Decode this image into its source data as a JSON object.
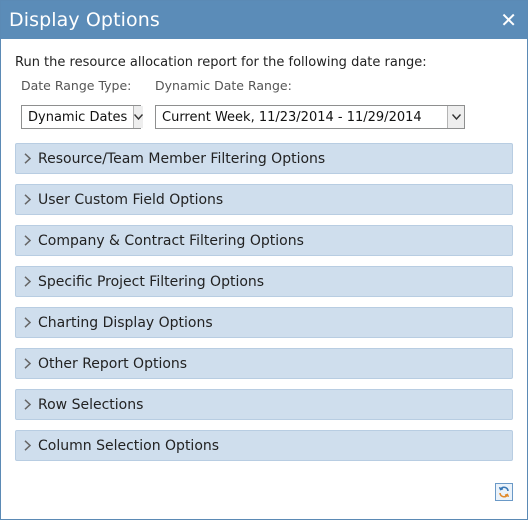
{
  "dialog": {
    "title": "Display Options",
    "close_glyph": "✕"
  },
  "intro_text": "Run the resource allocation report for the following date range:",
  "date_range_type": {
    "label": "Date Range Type:",
    "value": "Dynamic Dates"
  },
  "dynamic_date_range": {
    "label": "Dynamic Date Range:",
    "value": "Current Week, 11/23/2014 - 11/29/2014"
  },
  "sections": [
    {
      "label": "Resource/Team Member Filtering Options"
    },
    {
      "label": "User Custom Field Options"
    },
    {
      "label": "Company & Contract Filtering Options"
    },
    {
      "label": "Specific Project Filtering Options"
    },
    {
      "label": "Charting Display Options"
    },
    {
      "label": "Other Report Options"
    },
    {
      "label": "Row Selections"
    },
    {
      "label": "Column Selection Options"
    }
  ],
  "colors": {
    "titlebar": "#5b8cb8",
    "section_bg": "#cfdeed",
    "section_border": "#b8cde2"
  }
}
